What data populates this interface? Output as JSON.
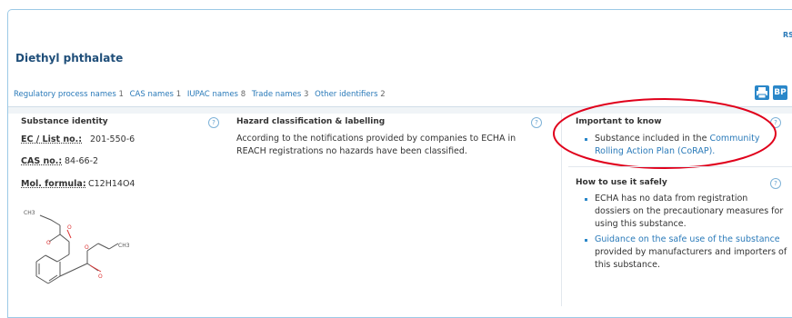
{
  "header": {
    "rss_label": "RS",
    "title": "Diethyl phthalate"
  },
  "tabs": [
    {
      "label": "Regulatory process names",
      "count": "1"
    },
    {
      "label": "CAS names",
      "count": "1"
    },
    {
      "label": "IUPAC names",
      "count": "8"
    },
    {
      "label": "Trade names",
      "count": "3"
    },
    {
      "label": "Other identifiers",
      "count": "2"
    }
  ],
  "tools": {
    "print_icon": "print-icon",
    "bp_label": "BP"
  },
  "identity": {
    "title": "Substance identity",
    "ec_label": "EC / List no.:",
    "ec_value": "201-550-6",
    "cas_label": "CAS no.:",
    "cas_value": "84-66-2",
    "mol_label": "Mol. formula:",
    "mol_value": "C12H14O4"
  },
  "structure": {
    "label_ch3_top": "CH3",
    "label_ch3_right": "CH3",
    "label_o": "O"
  },
  "hazard": {
    "title": "Hazard classification & labelling",
    "text": "According to the notifications provided by companies to ECHA in REACH registrations no hazards have been classified."
  },
  "important": {
    "title": "Important to know",
    "item_prefix": "Substance included in the ",
    "item_link": "Community Rolling Action Plan (CoRAP).",
    "highlight_color": "#e0001b"
  },
  "use_safely": {
    "title": "How to use it safely",
    "item1": "ECHA has no data from registration dossiers on the precautionary measures for using this substance.",
    "item2_link": "Guidance on the safe use of the substance",
    "item2_rest": " provided by manufacturers and importers of this substance."
  },
  "help_glyph": "?",
  "colors": {
    "accent": "#2a7ab9",
    "title": "#1f4e79",
    "border": "#9cc9e6"
  }
}
